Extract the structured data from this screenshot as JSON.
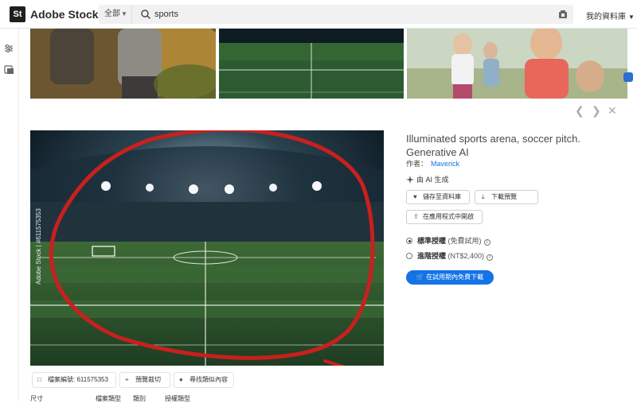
{
  "app": {
    "brand_mark": "St",
    "name": "Adobe Stock"
  },
  "search": {
    "filter_label": "全部",
    "query": "sports"
  },
  "header": {
    "my_library_label": "我的資料庫"
  },
  "asset": {
    "title": "Illuminated sports arena, soccer pitch. Generative AI",
    "author_label": "作者：",
    "author_name": "Maverick",
    "ai_label": "由 AI 生成",
    "watermark": "Adobe Stock | #611575353",
    "actions": {
      "save_to_library": "儲存至資料庫",
      "download_preview": "下載預覽",
      "open_in_app": "在應用程式中開啟"
    },
    "licenses": [
      {
        "name": "標準授權",
        "detail": "(免費試用)",
        "selected": true
      },
      {
        "name": "進階授權",
        "detail": "(NT$2,400)",
        "selected": false
      }
    ],
    "cta_label": "在試用期內免費下載",
    "file_id_label": "檔案編號:",
    "file_id": "611575353",
    "preview_crop_label": "預覽裁切",
    "find_similar_label": "尋找類似內容",
    "details_headers": [
      "尺寸",
      "檔案類型",
      "類別",
      "授權類型"
    ]
  },
  "colors": {
    "accent": "#1473e6",
    "annotation": "#c8201e"
  }
}
